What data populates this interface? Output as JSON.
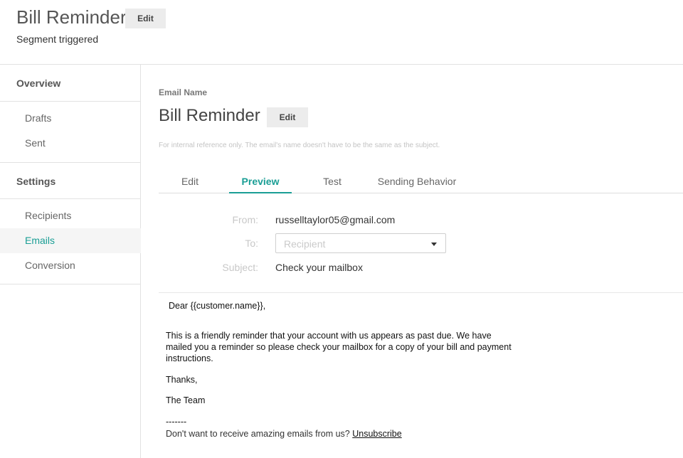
{
  "header": {
    "title": "Bill Reminder",
    "edit_label": "Edit",
    "subtitle": "Segment triggered"
  },
  "sidebar": {
    "overview": "Overview",
    "drafts": "Drafts",
    "sent": "Sent",
    "settings": "Settings",
    "recipients": "Recipients",
    "emails": "Emails",
    "conversion": "Conversion",
    "active": "Emails"
  },
  "main": {
    "email_name_label": "Email Name",
    "email_title": "Bill Reminder",
    "edit_label": "Edit",
    "hint": "For internal reference only. The email's name doesn't have to be the same as the subject.",
    "tabs": [
      {
        "label": "Edit"
      },
      {
        "label": "Preview"
      },
      {
        "label": "Test"
      },
      {
        "label": "Sending Behavior"
      }
    ],
    "active_tab": "Preview",
    "from_label": "From:",
    "from_value": "russelltaylor05@gmail.com",
    "to_label": "To:",
    "to_placeholder": "Recipient",
    "subject_label": "Subject:",
    "subject_value": "Check your mailbox"
  },
  "email_body": {
    "greeting": "Dear {{customer.name}},",
    "paragraph": "This is a friendly reminder that your account with us appears as past due. We have mailed you a reminder so please check your mailbox for a copy of your bill and payment instructions.",
    "thanks": "Thanks,",
    "signature": "The Team",
    "separator": "-------",
    "footer_text": "Don't want to receive amazing emails from us?",
    "unsubscribe": "Unsubscribe"
  },
  "colors": {
    "accent": "#1a9e95"
  }
}
